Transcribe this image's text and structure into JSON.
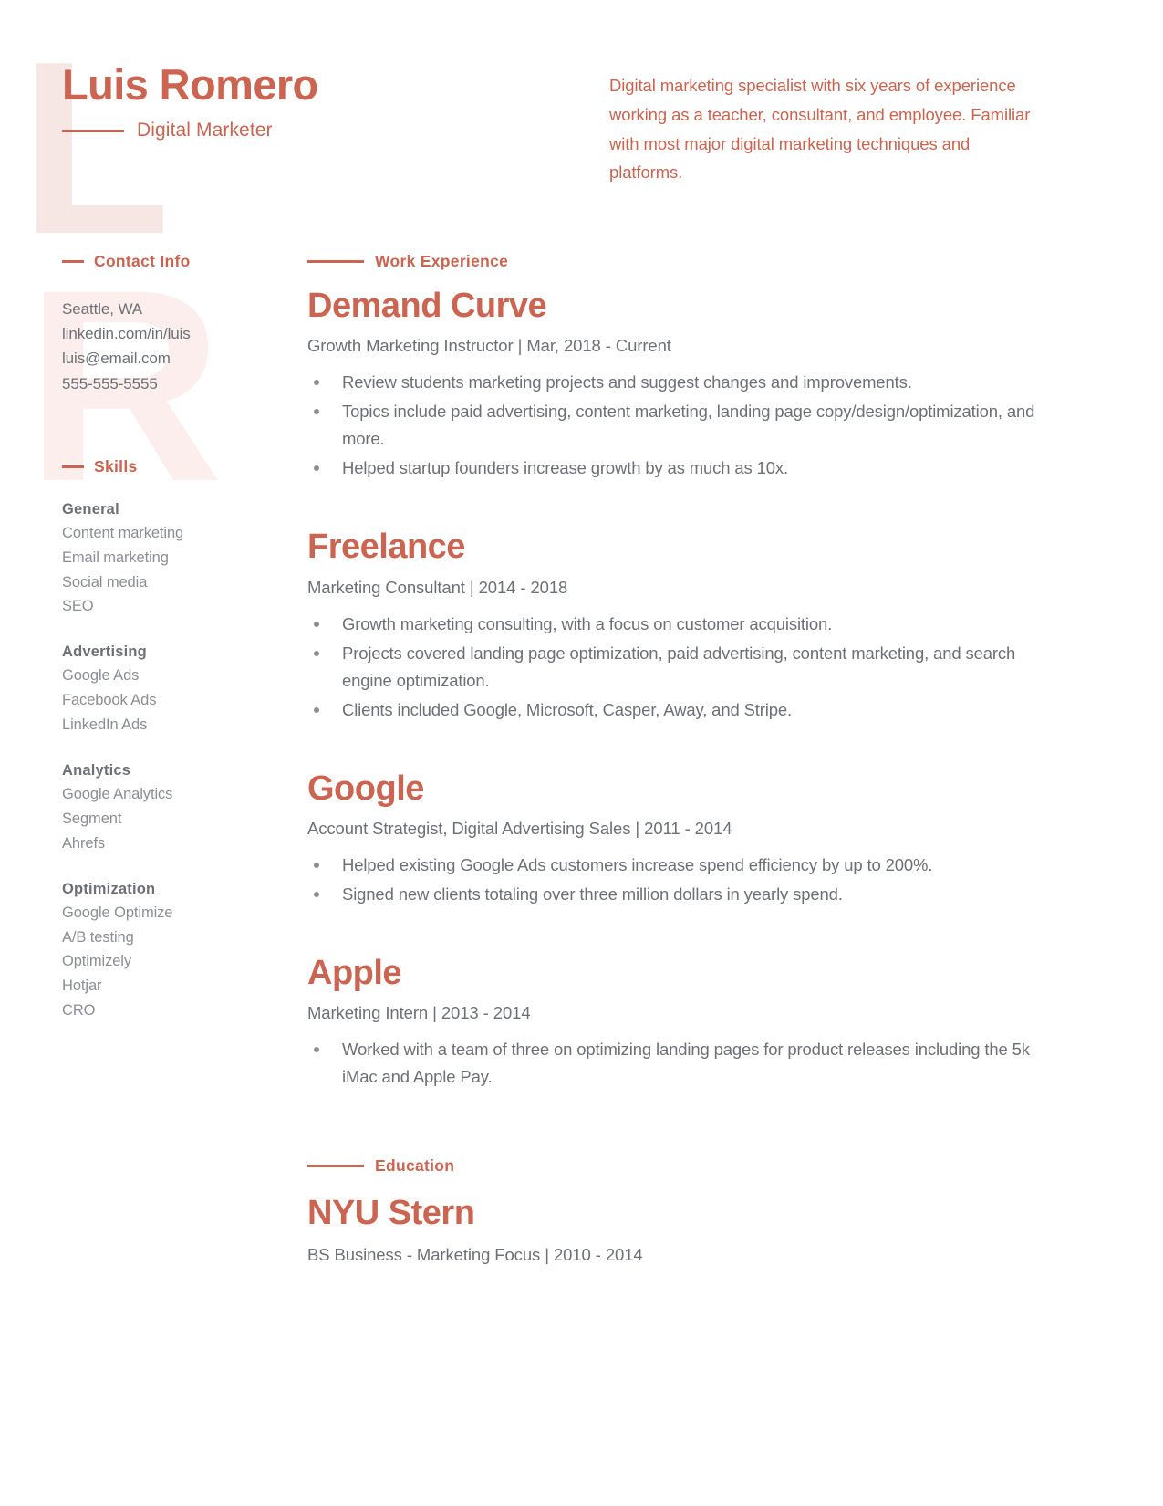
{
  "header": {
    "name": "Luis Romero",
    "job_title": "Digital Marketer",
    "summary": "Digital marketing specialist with six years of experience working as a teacher, consultant, and employee. Familiar with most major digital marketing techniques and platforms."
  },
  "watermark": {
    "letter_one": "L",
    "letter_two": "R"
  },
  "colors": {
    "accent": "#cb6450",
    "body_text": "#6d7175",
    "muted_text": "#8b8f93",
    "watermark": "#f7e7e4"
  },
  "sidebar": {
    "contact": {
      "heading": "Contact Info",
      "items": [
        "Seattle, WA",
        "linkedin.com/in/luis",
        "luis@email.com",
        "555-555-5555"
      ]
    },
    "skills": {
      "heading": "Skills",
      "groups": [
        {
          "title": "General",
          "items": [
            "Content marketing",
            "Email marketing",
            "Social media",
            "SEO"
          ]
        },
        {
          "title": "Advertising",
          "items": [
            "Google Ads",
            "Facebook Ads",
            "LinkedIn Ads"
          ]
        },
        {
          "title": "Analytics",
          "items": [
            "Google Analytics",
            "Segment",
            "Ahrefs"
          ]
        },
        {
          "title": "Optimization",
          "items": [
            "Google Optimize",
            "A/B testing",
            "Optimizely",
            "Hotjar",
            "CRO"
          ]
        }
      ]
    }
  },
  "main": {
    "work_experience": {
      "heading": "Work Experience",
      "jobs": [
        {
          "company": "Demand Curve",
          "meta": "Growth Marketing Instructor | Mar, 2018 - Current",
          "bullets": [
            "Review students marketing projects and suggest changes and improvements.",
            "Topics include paid advertising, content marketing, landing page copy/design/optimization, and more.",
            "Helped startup founders increase growth by as much as 10x."
          ]
        },
        {
          "company": "Freelance",
          "meta": "Marketing Consultant | 2014 - 2018",
          "bullets": [
            "Growth marketing consulting, with a focus on customer acquisition.",
            "Projects covered landing page optimization, paid advertising, content marketing, and search engine optimization.",
            "Clients included Google, Microsoft, Casper, Away, and Stripe."
          ]
        },
        {
          "company": "Google",
          "meta": "Account Strategist, Digital Advertising Sales | 2011 - 2014",
          "bullets": [
            "Helped existing Google Ads customers increase spend efficiency by up to 200%.",
            "Signed new clients totaling over three million dollars in yearly spend."
          ]
        },
        {
          "company": "Apple",
          "meta": "Marketing Intern | 2013 - 2014",
          "bullets": [
            "Worked with a team of three on optimizing landing pages for product releases including the 5k iMac and Apple Pay."
          ]
        }
      ]
    },
    "education": {
      "heading": "Education",
      "school": "NYU Stern",
      "meta": "BS Business - Marketing Focus | 2010 - 2014"
    }
  }
}
